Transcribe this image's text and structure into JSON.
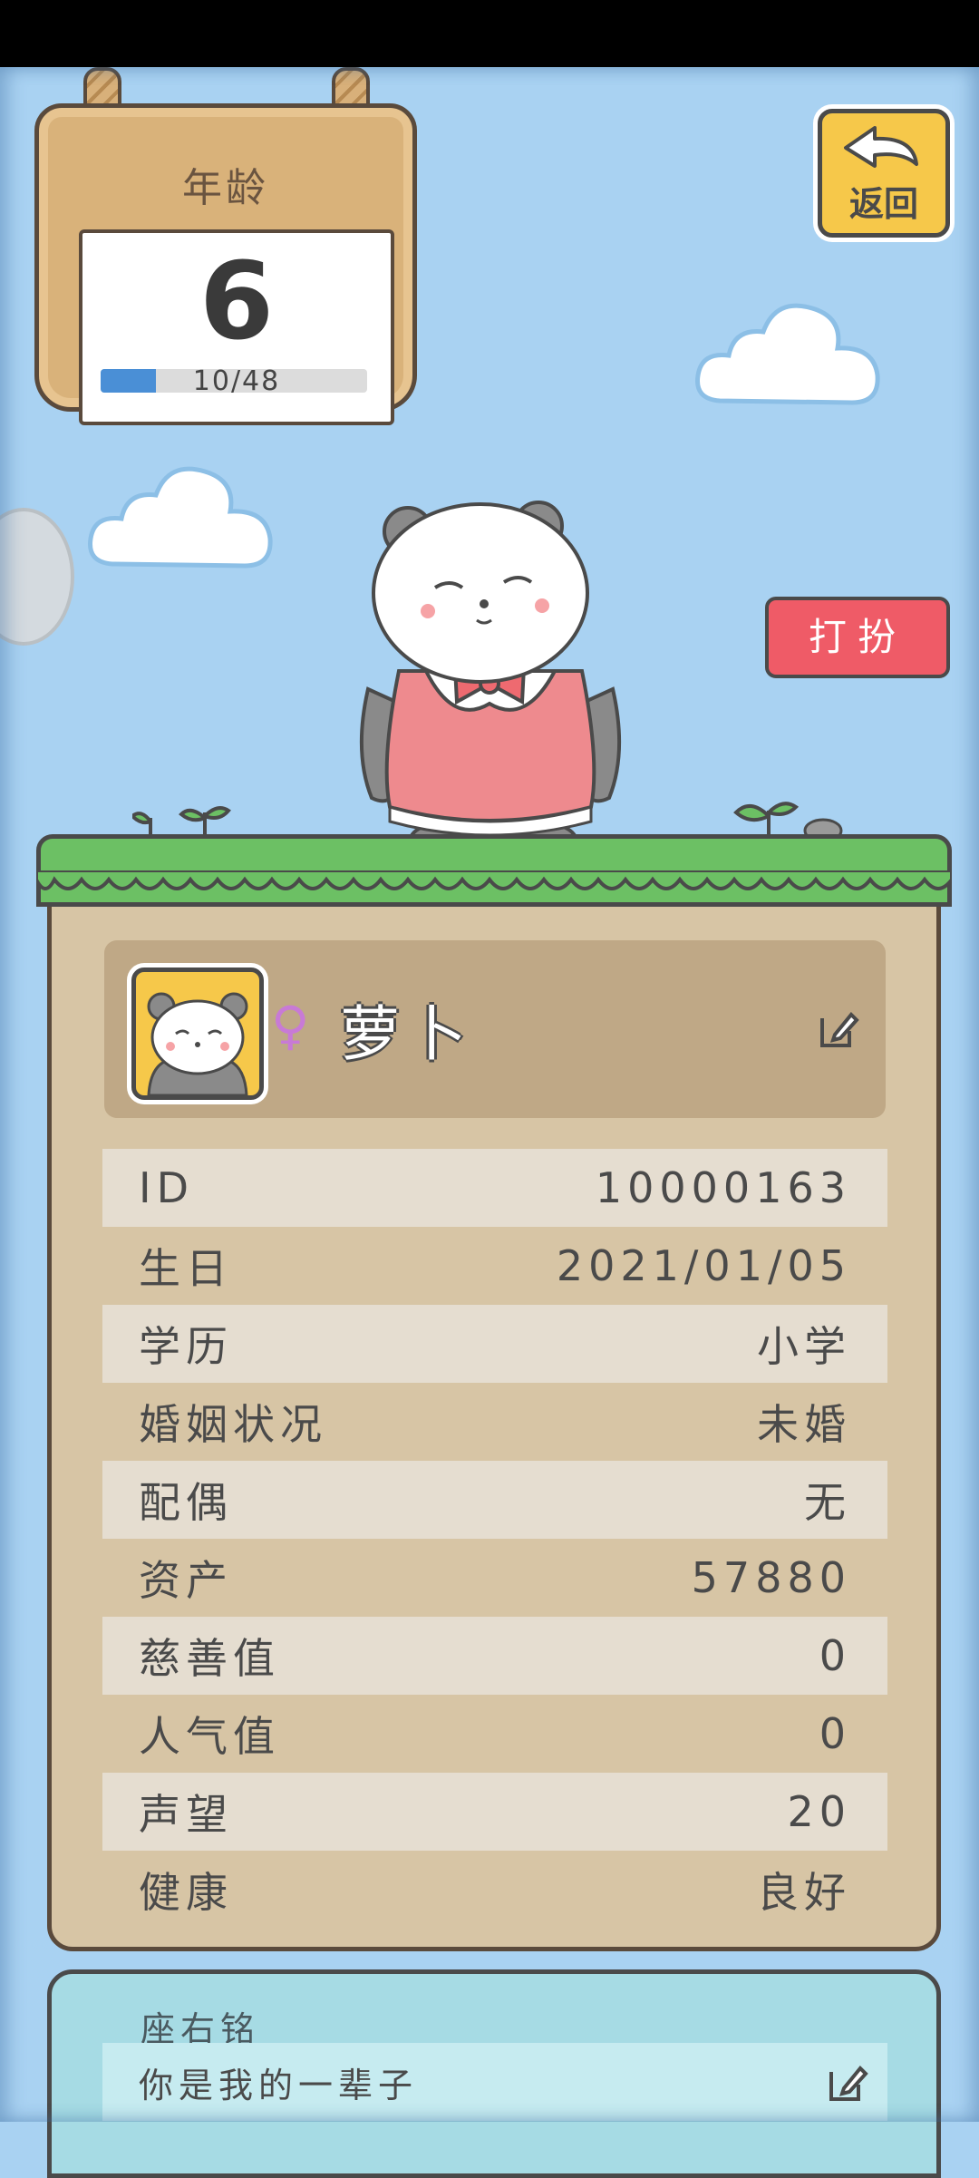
{
  "age_sign": {
    "title": "年龄",
    "age": "6",
    "progress_text": "10/48",
    "progress_fraction": 0.2083
  },
  "back_button": {
    "label": "返回"
  },
  "dress_button": {
    "label": "打扮"
  },
  "profile": {
    "gender_symbol": "♀",
    "name": "萝卜"
  },
  "info_rows": [
    {
      "label": "ID",
      "value": "10000163"
    },
    {
      "label": "生日",
      "value": "2021/01/05"
    },
    {
      "label": "学历",
      "value": "小学"
    },
    {
      "label": "婚姻状况",
      "value": "未婚"
    },
    {
      "label": "配偶",
      "value": "无"
    },
    {
      "label": "资产",
      "value": "57880"
    },
    {
      "label": "慈善值",
      "value": "0"
    },
    {
      "label": "人气值",
      "value": "0"
    },
    {
      "label": "声望",
      "value": "20"
    },
    {
      "label": "健康",
      "value": "良好"
    }
  ],
  "motto": {
    "title": "座右铭",
    "text": "你是我的一辈子"
  },
  "colors": {
    "sky": "#a9d2f2",
    "button_red": "#ef5b67",
    "button_yellow": "#f6c84a",
    "grass": "#6cc064",
    "panel": "#d7c5a5"
  }
}
